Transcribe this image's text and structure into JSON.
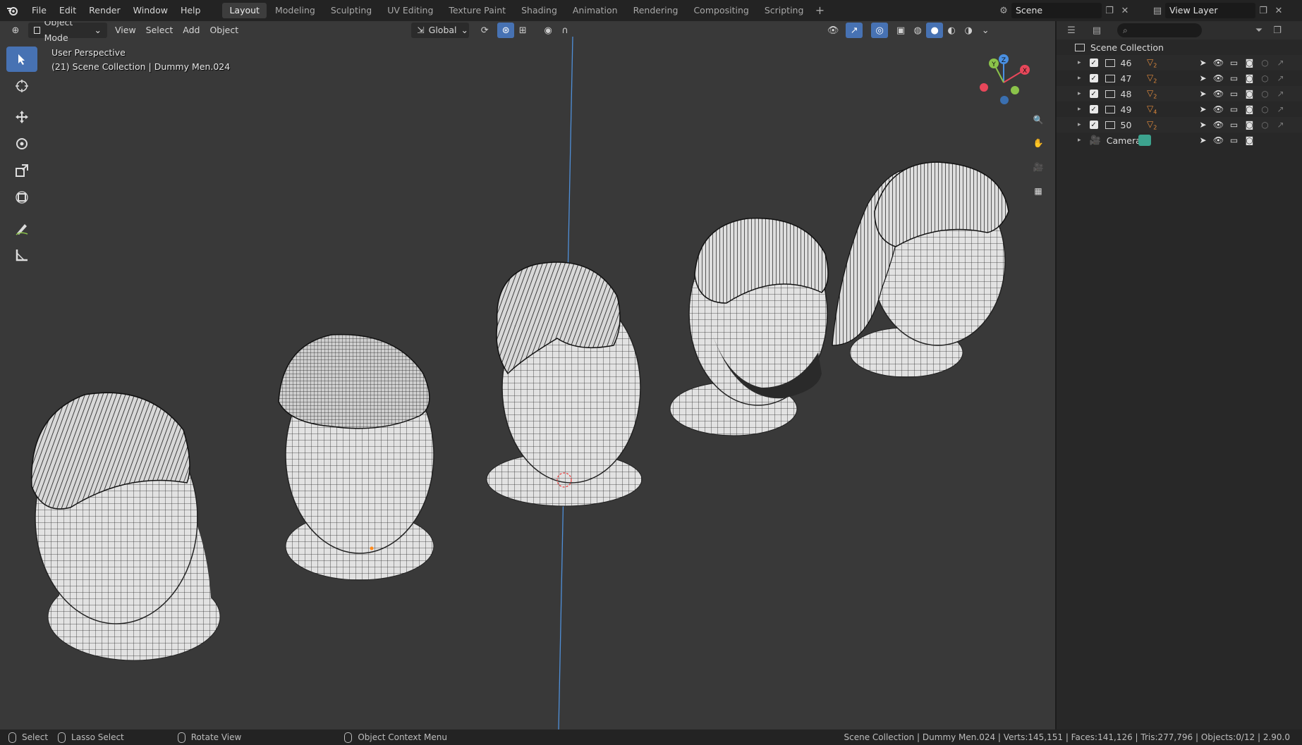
{
  "topbar": {
    "menus": [
      "File",
      "Edit",
      "Render",
      "Window",
      "Help"
    ],
    "workspaces": [
      "Layout",
      "Modeling",
      "Sculpting",
      "UV Editing",
      "Texture Paint",
      "Shading",
      "Animation",
      "Rendering",
      "Compositing",
      "Scripting"
    ],
    "active_workspace": "Layout",
    "add_tab": "+",
    "scene": "Scene",
    "view_layer": "View Layer"
  },
  "viewport_header": {
    "mode": "Object Mode",
    "menus": [
      "View",
      "Select",
      "Add",
      "Object"
    ],
    "transform_orientation": "Global"
  },
  "viewport": {
    "view_name": "User Perspective",
    "context": "(21) Scene Collection | Dummy Men.024"
  },
  "outliner": {
    "root": "Scene Collection",
    "items": [
      {
        "name": "46",
        "badge": "2"
      },
      {
        "name": "47",
        "badge": "2"
      },
      {
        "name": "48",
        "badge": "2"
      },
      {
        "name": "49",
        "badge": "4"
      },
      {
        "name": "50",
        "badge": "2"
      },
      {
        "name": "Camera",
        "badge": ""
      }
    ]
  },
  "statusbar": {
    "select": "Select",
    "lasso": "Lasso Select",
    "rotate": "Rotate View",
    "context_menu": "Object Context Menu",
    "stats": "Scene Collection | Dummy Men.024 | Verts:145,151 | Faces:141,126 | Tris:277,796 | Objects:0/12 | 2.90.0"
  },
  "colors": {
    "accent": "#4772b3",
    "axis_x": "#e8475a",
    "axis_y": "#8bc34a",
    "axis_z": "#4a90e2",
    "collection_icon": "#e08a3c",
    "camera_icon": "#3ca38e"
  }
}
